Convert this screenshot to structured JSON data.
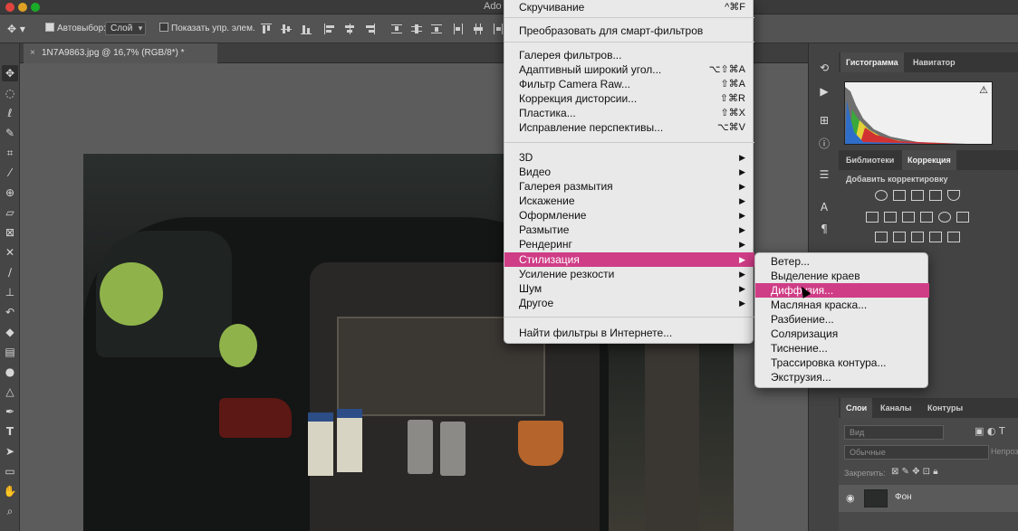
{
  "window": {
    "title_fragment": "Ado"
  },
  "options_bar": {
    "auto_select_label": "Автовыбор:",
    "auto_select_value": "Слой",
    "show_transform_label": "Показать упр. элем."
  },
  "document_tab": {
    "title": "1N7A9863.jpg @ 16,7% (RGB/8*) *",
    "close": "×"
  },
  "filter_menu": {
    "items": [
      {
        "label": "Скручивание",
        "shortcut": "^⌘F"
      },
      {
        "label": "Преобразовать для смарт-фильтров",
        "shortcut": ""
      },
      {
        "label": "Галерея фильтров...",
        "shortcut": ""
      },
      {
        "label": "Адаптивный широкий угол...",
        "shortcut": "⌥⇧⌘A"
      },
      {
        "label": "Фильтр Camera Raw...",
        "shortcut": "⇧⌘A"
      },
      {
        "label": "Коррекция дисторсии...",
        "shortcut": "⇧⌘R"
      },
      {
        "label": "Пластика...",
        "shortcut": "⇧⌘X"
      },
      {
        "label": "Исправление перспективы...",
        "shortcut": "⌥⌘V"
      },
      {
        "label": "3D",
        "shortcut": ""
      },
      {
        "label": "Видео",
        "shortcut": ""
      },
      {
        "label": "Галерея размытия",
        "shortcut": ""
      },
      {
        "label": "Искажение",
        "shortcut": ""
      },
      {
        "label": "Оформление",
        "shortcut": ""
      },
      {
        "label": "Размытие",
        "shortcut": ""
      },
      {
        "label": "Рендеринг",
        "shortcut": ""
      },
      {
        "label": "Стилизация",
        "shortcut": ""
      },
      {
        "label": "Усиление резкости",
        "shortcut": ""
      },
      {
        "label": "Шум",
        "shortcut": ""
      },
      {
        "label": "Другое",
        "shortcut": ""
      },
      {
        "label": "Найти фильтры в Интернете...",
        "shortcut": ""
      }
    ],
    "submenu_arrow": "▶"
  },
  "stylize_submenu": {
    "items": [
      "Ветер...",
      "Выделение краев",
      "Диффузия...",
      "Масляная краска...",
      "Разбиение...",
      "Соляризация",
      "Тиснение...",
      "Трассировка контура...",
      "Экструзия..."
    ]
  },
  "panels": {
    "top_tabs": [
      "Гистограмма",
      "Навигатор"
    ],
    "mid_tabs": [
      "Библиотеки",
      "Коррекция"
    ],
    "adjustments_label": "Добавить корректировку",
    "layers_tabs": [
      "Слои",
      "Каналы",
      "Контуры"
    ],
    "layer_filter_placeholder": "Вид",
    "blend_mode": "Обычные",
    "opacity_label": "Непроз",
    "lock_label": "Закрепить:",
    "layer_name": "Фон",
    "warning_icon": "⚠"
  },
  "colors": {
    "highlight": "#cf3d86",
    "menu_bg": "#e9e9e9",
    "ui_dark": "#434343"
  }
}
